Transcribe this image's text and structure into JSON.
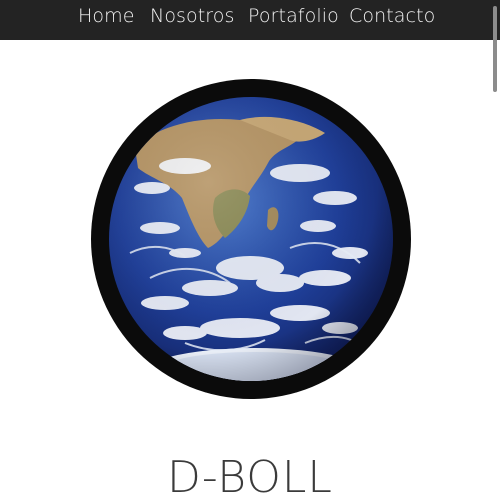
{
  "nav": {
    "items": [
      {
        "label": "Home"
      },
      {
        "label": "Nosotros"
      },
      {
        "label": "Portafolio"
      },
      {
        "label": "Contacto"
      }
    ]
  },
  "hero": {
    "image_icon": "earth-globe-icon",
    "title": "D-BOLL"
  },
  "colors": {
    "navbar_bg": "#232323",
    "nav_text": "#f2f2f2",
    "frame_ring": "#0b0b0b",
    "title_text": "#3b3b3b",
    "page_bg": "#ffffff"
  }
}
